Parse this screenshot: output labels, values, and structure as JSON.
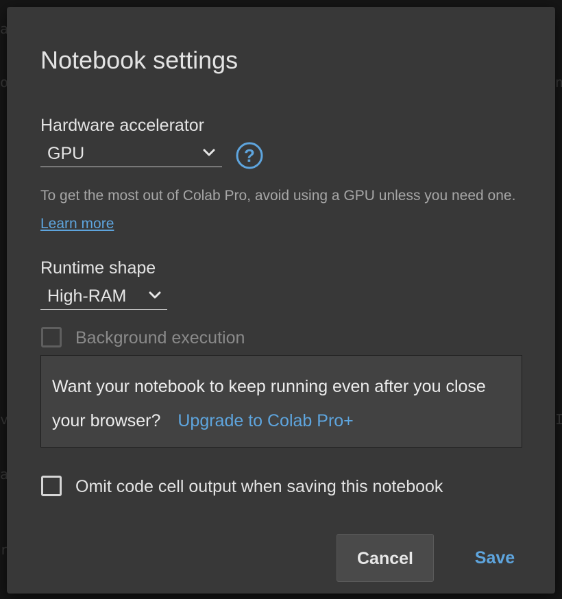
{
  "dialog": {
    "title": "Notebook settings"
  },
  "hardware_accelerator": {
    "label": "Hardware accelerator",
    "selected": "GPU",
    "help_icon": "help-circle-icon",
    "hint_text": "To get the most out of Colab Pro, avoid using a GPU unless you need one.",
    "learn_more_label": "Learn more"
  },
  "runtime_shape": {
    "label": "Runtime shape",
    "selected": "High-RAM"
  },
  "background_execution": {
    "label": "Background execution",
    "checked": false,
    "disabled": true,
    "promo_text": "Want your notebook to keep running even after you close your browser?",
    "promo_link": "Upgrade to Colab Pro+"
  },
  "omit_output": {
    "label": "Omit code cell output when saving this notebook",
    "checked": false
  },
  "actions": {
    "cancel_label": "Cancel",
    "save_label": "Save"
  },
  "colors": {
    "accent": "#5ea5de",
    "dialog_bg": "#383838",
    "text": "#e3e3e3",
    "muted": "#a6a6a6"
  }
}
